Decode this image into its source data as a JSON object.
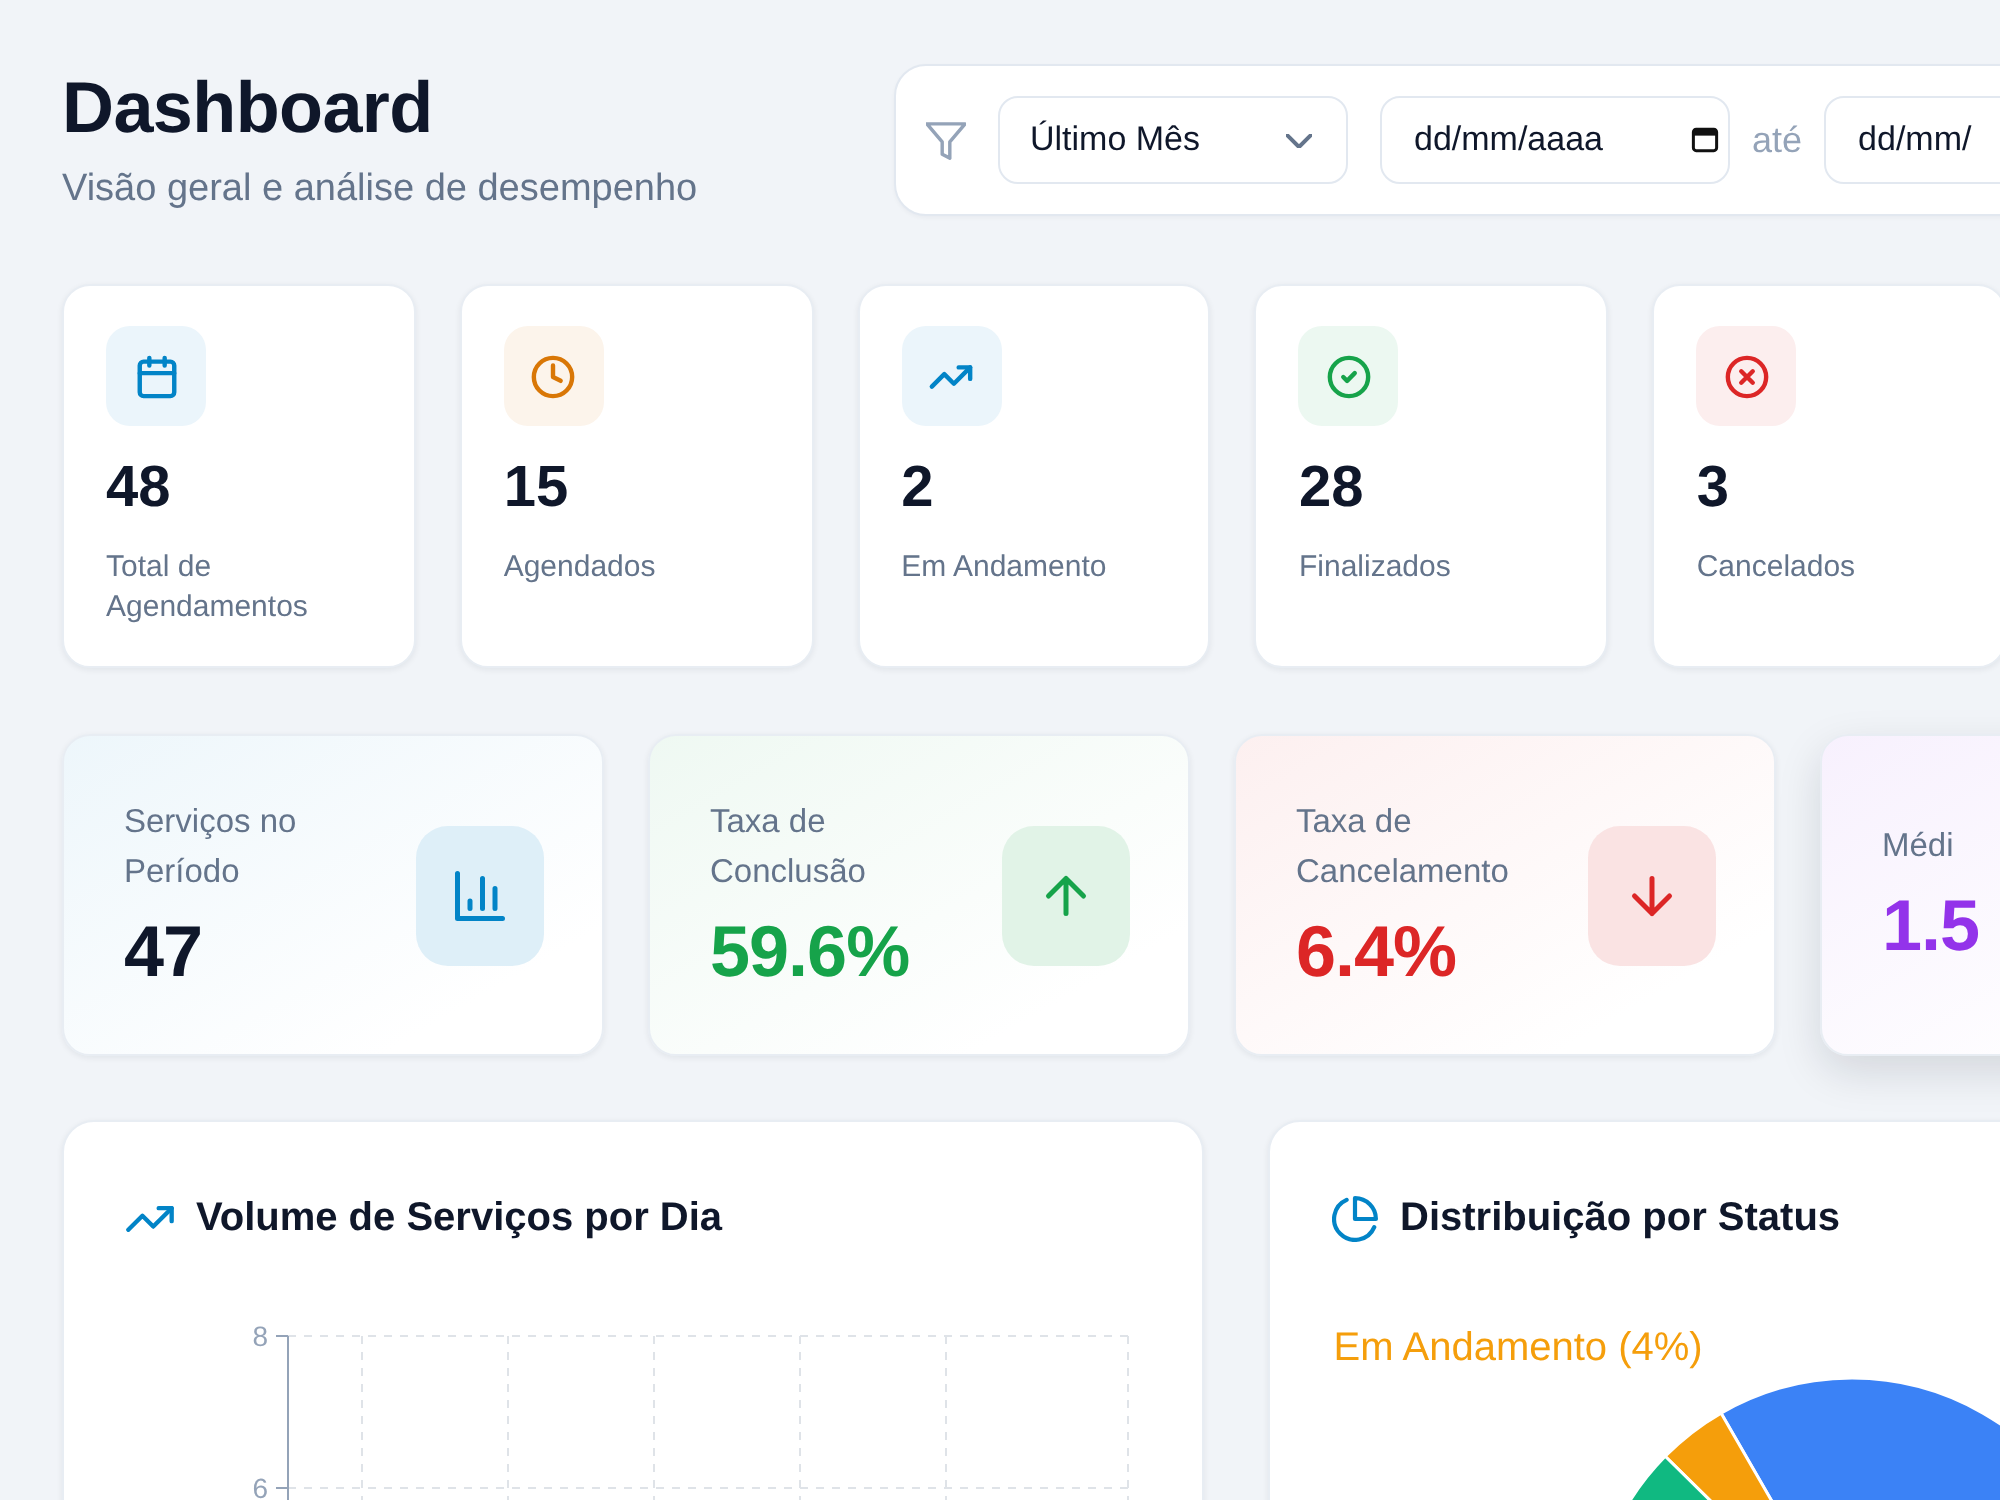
{
  "header": {
    "title": "Dashboard",
    "subtitle": "Visão geral e análise de desempenho"
  },
  "filters": {
    "period": {
      "value": "Último Mês"
    },
    "date_from": {
      "placeholder": "dd/mm/aaaa"
    },
    "separator": "até",
    "date_to": {
      "placeholder": "dd/mm/"
    }
  },
  "stats": [
    {
      "value": "48",
      "label": "Total de Agendamentos",
      "color": "#0284c7"
    },
    {
      "value": "15",
      "label": "Agendados",
      "color": "#d97706"
    },
    {
      "value": "2",
      "label": "Em Andamento",
      "color": "#0284c7"
    },
    {
      "value": "28",
      "label": "Finalizados",
      "color": "#16a34a"
    },
    {
      "value": "3",
      "label": "Cancelados",
      "color": "#dc2626"
    }
  ],
  "metrics": [
    {
      "kind": "count",
      "label": "Serviços no Período",
      "value": "47",
      "color": "#0284c7",
      "hovered": false
    },
    {
      "kind": "rise",
      "label": "Taxa de Conclusão",
      "value": "59.6%",
      "color": "#16a34a",
      "hovered": false
    },
    {
      "kind": "fall",
      "label": "Taxa de Cancelamento",
      "value": "6.4%",
      "color": "#dc2626",
      "hovered": false
    },
    {
      "kind": "average",
      "label": "Médi",
      "value": "1.5",
      "color": "#9333ea",
      "hovered": true
    }
  ],
  "charts": [
    {
      "kind": "line",
      "title": "Volume de Serviços por Dia",
      "axis_labels": [
        "8",
        "6"
      ]
    },
    {
      "kind": "pie",
      "title": "Distribuição por Status",
      "chart_data": {
        "type": "pie",
        "categories": [
          null,
          "Em Andamento (4%)",
          null
        ],
        "values": [
          31,
          4,
          58
        ],
        "colors": [
          "#3b82f6",
          "#f59e0b",
          "#10b981"
        ]
      }
    }
  ]
}
